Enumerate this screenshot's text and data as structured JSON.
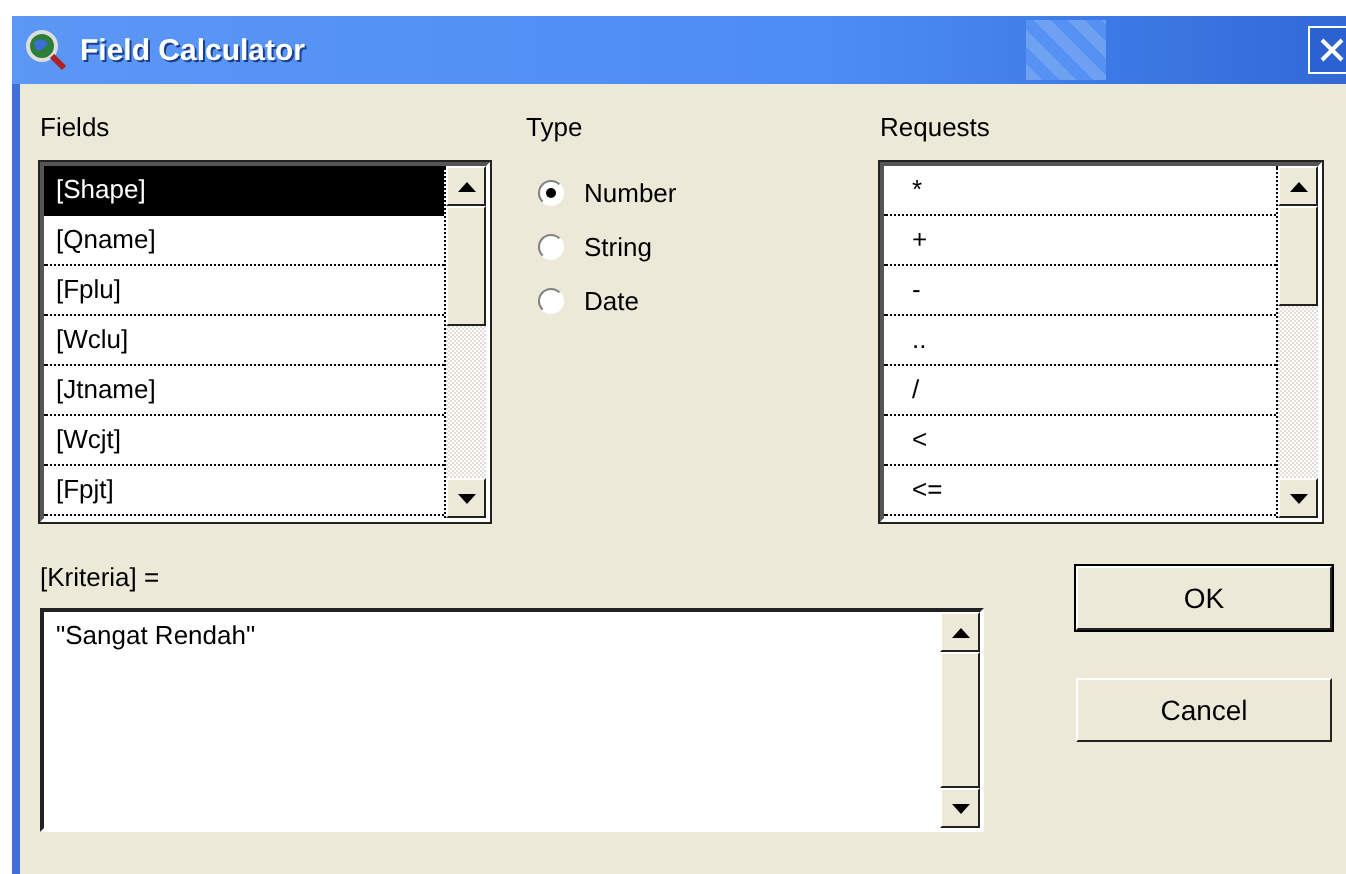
{
  "window": {
    "title": "Field Calculator"
  },
  "fields": {
    "label": "Fields",
    "items": [
      {
        "name": "[Shape]",
        "selected": true
      },
      {
        "name": "[Qname]",
        "selected": false
      },
      {
        "name": "[Fplu]",
        "selected": false
      },
      {
        "name": "[Wclu]",
        "selected": false
      },
      {
        "name": "[Jtname]",
        "selected": false
      },
      {
        "name": "[Wcjt]",
        "selected": false
      },
      {
        "name": "[Fpjt]",
        "selected": false
      }
    ]
  },
  "type": {
    "label": "Type",
    "options": [
      {
        "label": "Number",
        "selected": true
      },
      {
        "label": "String",
        "selected": false
      },
      {
        "label": "Date",
        "selected": false
      }
    ]
  },
  "requests": {
    "label": "Requests",
    "items": [
      {
        "name": "*",
        "selected": false
      },
      {
        "name": "+",
        "selected": false
      },
      {
        "name": "-",
        "selected": false
      },
      {
        "name": "..",
        "selected": false
      },
      {
        "name": "/",
        "selected": false
      },
      {
        "name": "<",
        "selected": false
      },
      {
        "name": "<=",
        "selected": false
      }
    ]
  },
  "expression": {
    "label": "[Kriteria] =",
    "value": "\"Sangat Rendah\""
  },
  "buttons": [
    "OK",
    "Cancel"
  ]
}
